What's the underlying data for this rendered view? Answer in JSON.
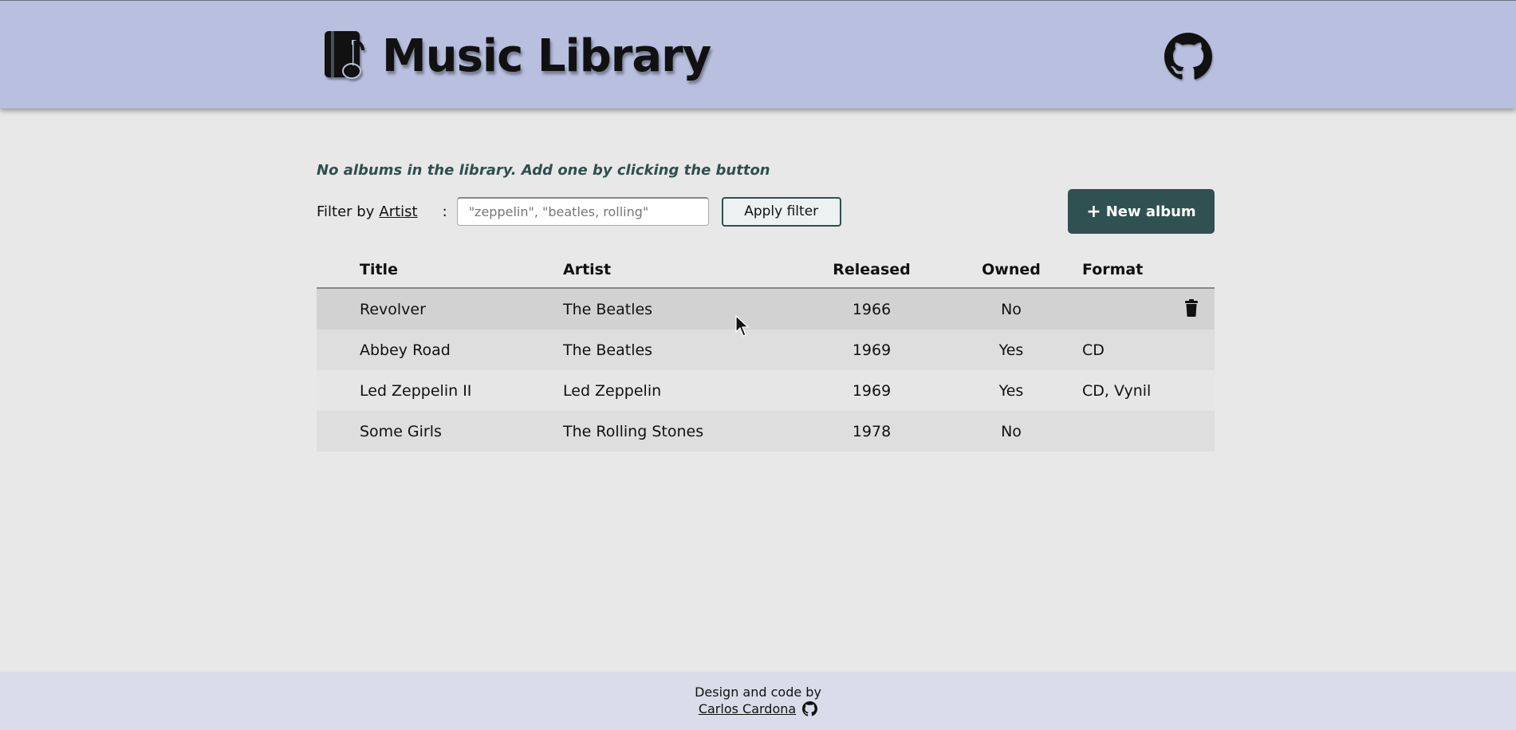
{
  "header": {
    "app_title": "Music Library",
    "logo_icon": "music-album-icon",
    "github_icon": "github-icon"
  },
  "notice": "No albums in the library. Add one by clicking the button",
  "filter": {
    "label": "Filter by",
    "field": "Artist",
    "colon": ":",
    "placeholder": "\"zeppelin\", \"beatles, rolling\"",
    "value": "",
    "apply_label": "Apply filter"
  },
  "new_album_label": "New album",
  "table": {
    "columns": [
      "Title",
      "Artist",
      "Released",
      "Owned",
      "Format"
    ],
    "rows": [
      {
        "title": "Revolver",
        "artist": "The Beatles",
        "released": "1966",
        "owned": "No",
        "format": ""
      },
      {
        "title": "Abbey Road",
        "artist": "The Beatles",
        "released": "1969",
        "owned": "Yes",
        "format": "CD"
      },
      {
        "title": "Led Zeppelin II",
        "artist": "Led Zeppelin",
        "released": "1969",
        "owned": "Yes",
        "format": "CD, Vynil"
      },
      {
        "title": "Some Girls",
        "artist": "The Rolling Stones",
        "released": "1978",
        "owned": "No",
        "format": ""
      }
    ]
  },
  "footer": {
    "line1": "Design and code by",
    "author": "Carlos Cardona"
  },
  "colors": {
    "header_bg": "#b8bfdf",
    "accent": "#2f5152",
    "page_bg": "#e8e8e8",
    "footer_bg": "#dadcea"
  }
}
